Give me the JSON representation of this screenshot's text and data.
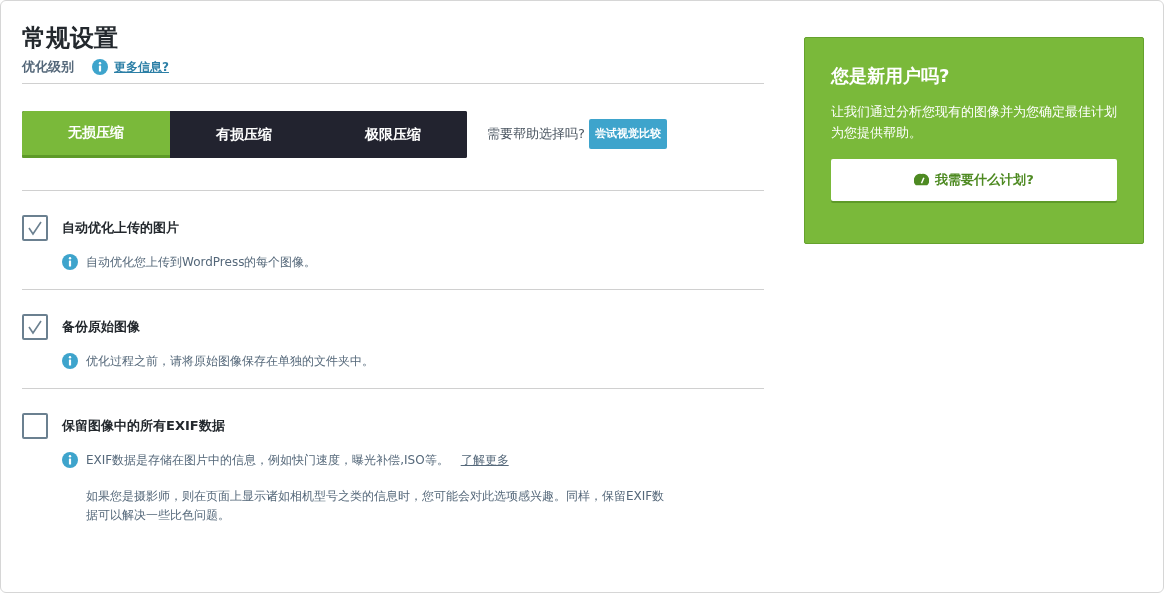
{
  "title": "常规设置",
  "level_section": {
    "label": "优化级别",
    "info_link": "更多信息?"
  },
  "levels": [
    {
      "label": "无损压缩",
      "selected": true
    },
    {
      "label": "有损压缩",
      "selected": false
    },
    {
      "label": "极限压缩",
      "selected": false
    }
  ],
  "help": {
    "text": "需要帮助选择吗?",
    "button": "尝试视觉比较"
  },
  "options": [
    {
      "label": "自动优化上传的图片",
      "checked": true,
      "info": "自动优化您上传到WordPress的每个图像。"
    },
    {
      "label": "备份原始图像",
      "checked": true,
      "info": "优化过程之前，请将原始图像保存在单独的文件夹中。"
    },
    {
      "label": "保留图像中的所有EXIF数据",
      "checked": false,
      "info": "EXIF数据是存储在图片中的信息，例如快门速度，曝光补偿,ISO等。",
      "link": "了解更多",
      "note": "如果您是摄影师，则在页面上显示诸如相机型号之类的信息时，您可能会对此选项感兴趣。同样，保留EXIF数据可以解决一些比色问题。"
    }
  ],
  "new_user_card": {
    "title": "您是新用户吗?",
    "text": "让我们通过分析您现有的图像并为您确定最佳计划为您提供帮助。",
    "button": "我需要什么计划?"
  }
}
